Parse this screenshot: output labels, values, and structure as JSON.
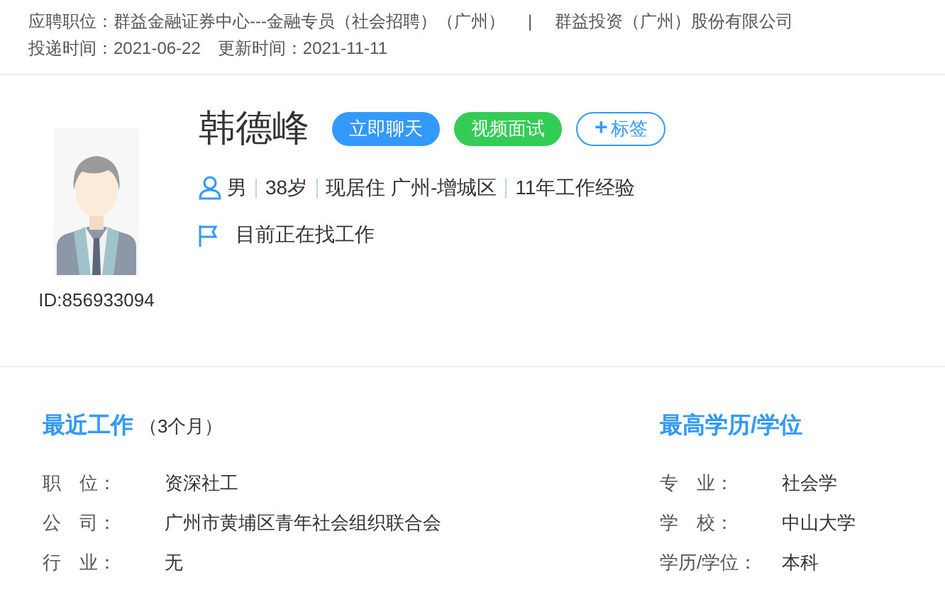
{
  "header": {
    "position_label": "应聘职位：",
    "position": "群益金融证券中心---金融专员（社会招聘）（广州）",
    "separator": "|",
    "company": "群益投资（广州）股份有限公司",
    "applied_label": "投递时间：",
    "applied": "2021-06-22",
    "updated_label": "更新时间：",
    "updated": "2021-11-11"
  },
  "profile": {
    "id": "ID:856933094",
    "name": "韩德峰",
    "buttons": [
      {
        "kind": "chat",
        "label": "立即聊天"
      },
      {
        "kind": "video",
        "label": "视频面试"
      },
      {
        "kind": "tag",
        "icon": "+",
        "label": "标签"
      }
    ],
    "facts": [
      "男",
      "38岁",
      "现居住 广州-增城区",
      "11年工作经验"
    ],
    "status": "目前正在找工作"
  },
  "recent_work": {
    "title": "最近工作",
    "duration": "（3个月）",
    "rows": [
      {
        "label": "职　位：",
        "value": "资深社工"
      },
      {
        "label": "公　司：",
        "value": "广州市黄埔区青年社会组织联合会"
      },
      {
        "label": "行　业：",
        "value": "无"
      }
    ]
  },
  "education": {
    "title": "最高学历/学位",
    "rows": [
      {
        "label": "专　业：",
        "value": "社会学"
      },
      {
        "label": "学　校：",
        "value": "中山大学"
      },
      {
        "label": "学历/学位：",
        "value": "本科"
      }
    ]
  }
}
